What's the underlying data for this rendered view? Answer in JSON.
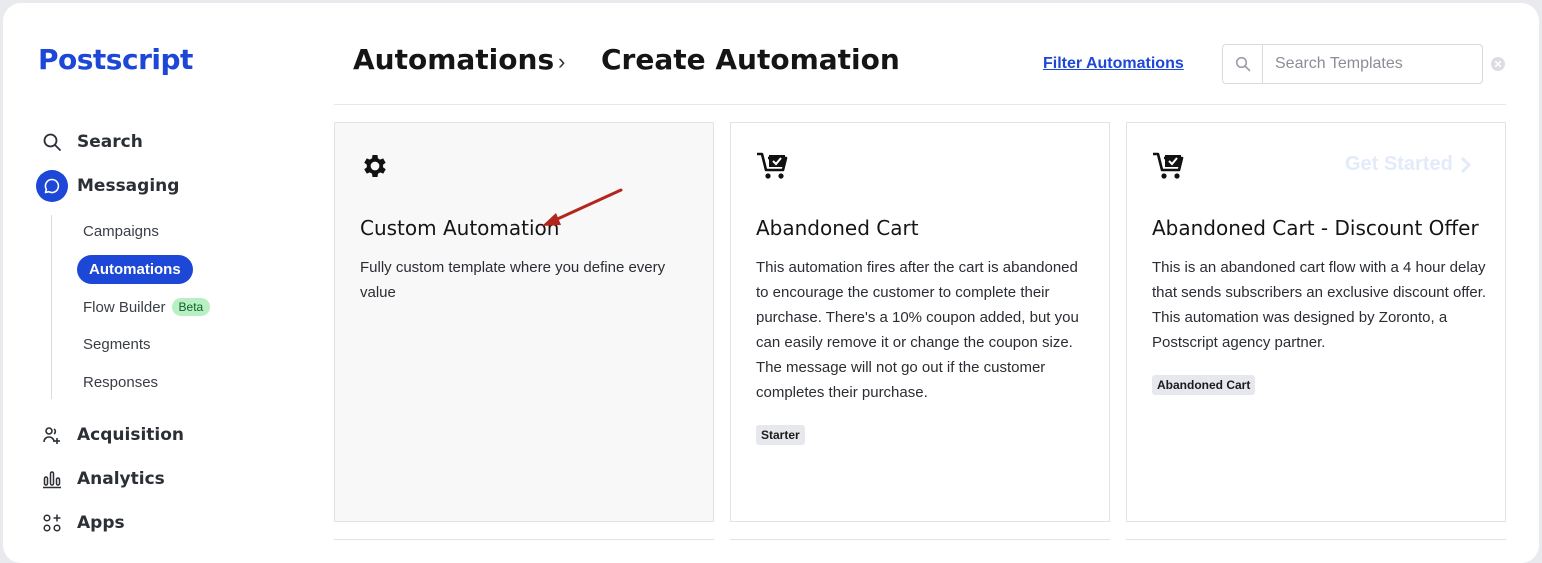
{
  "app": {
    "logo": "Postscript"
  },
  "sidebar": {
    "items": [
      {
        "label": "Search",
        "icon": "search-icon"
      },
      {
        "label": "Messaging",
        "icon": "chat-bubble-icon",
        "active": true
      },
      {
        "label": "Acquisition",
        "icon": "add-users-icon"
      },
      {
        "label": "Analytics",
        "icon": "bar-chart-icon"
      },
      {
        "label": "Apps",
        "icon": "apps-grid-icon"
      }
    ],
    "messaging_sub": [
      {
        "label": "Campaigns"
      },
      {
        "label": "Automations",
        "active": true
      },
      {
        "label": "Flow Builder",
        "badge": "Beta"
      },
      {
        "label": "Segments"
      },
      {
        "label": "Responses"
      }
    ]
  },
  "header": {
    "breadcrumb_root": "Automations",
    "breadcrumb_sep": "›",
    "breadcrumb_current": "Create Automation",
    "filter_link": "Filter Automations",
    "search_placeholder": "Search Templates"
  },
  "cards": [
    {
      "icon": "gear-icon",
      "title": "Custom Automation",
      "description": "Fully custom template where you define every value"
    },
    {
      "icon": "cart-icon",
      "title": "Abandoned Cart",
      "description": "This automation fires after the cart is abandoned to encourage the customer to complete their purchase. There's a 10% coupon added, but you can easily remove it or change the coupon size. The message will not go out if the customer completes their purchase.",
      "tag": "Starter"
    },
    {
      "icon": "cart-icon",
      "title": "Abandoned Cart - Discount Offer",
      "description": "This is an abandoned cart flow with a 4 hour delay that sends subscribers an exclusive discount offer. This automation was designed by Zoronto, a Postscript agency partner.",
      "tag": "Abandoned Cart",
      "action": "Get Started"
    }
  ],
  "colors": {
    "brand": "#1d47d6",
    "beta_badge": "#b8f0c4",
    "annotation_arrow": "#b3261e"
  }
}
